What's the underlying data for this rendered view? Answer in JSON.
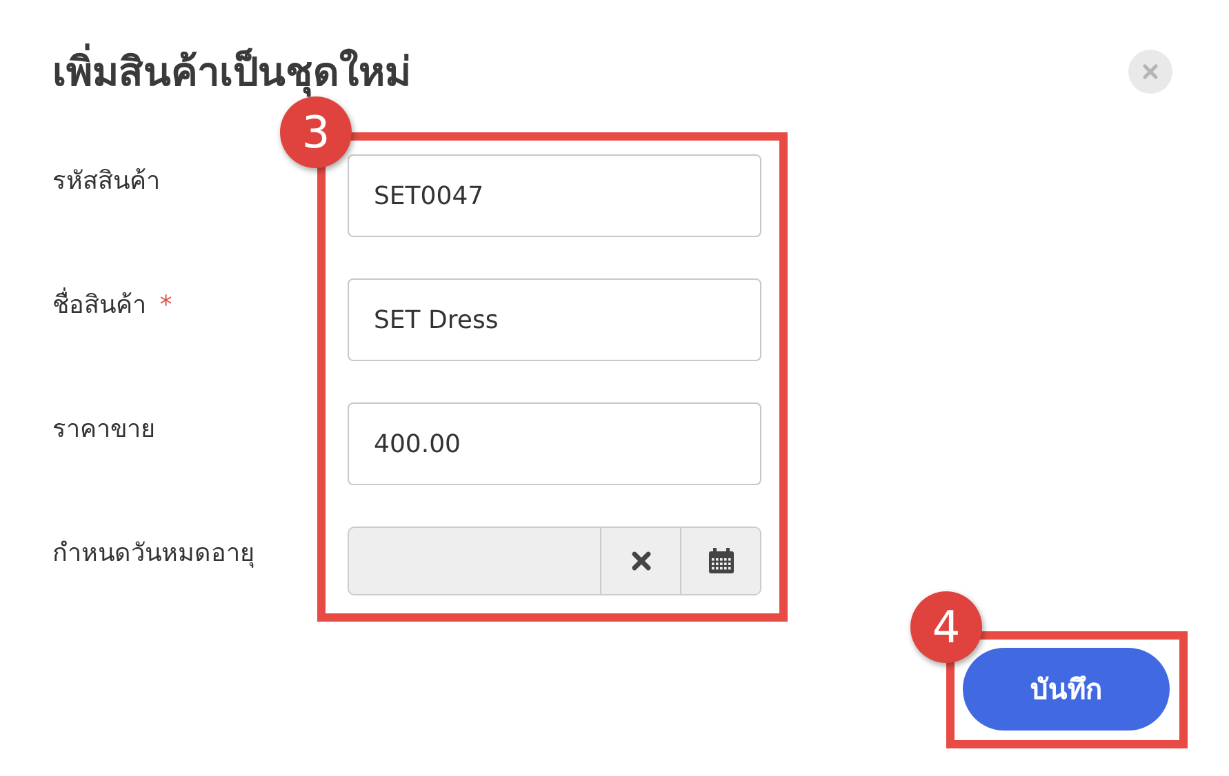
{
  "dialog": {
    "title": "เพิ่มสินค้าเป็นชุดใหม่"
  },
  "fields": [
    {
      "kind": "text",
      "label": "รหัสสินค้า",
      "value": "SET0047"
    },
    {
      "kind": "text",
      "label": "ชื่อสินค้า",
      "required_mark": "*",
      "value": "SET Dress"
    },
    {
      "kind": "text",
      "label": "ราคาขาย",
      "value": "400.00"
    },
    {
      "kind": "date",
      "label": "กำหนดวันหมดอายุ",
      "disabled": true
    }
  ],
  "save_button": {
    "label": "บันทึก"
  },
  "fields_badge": {
    "label": "3"
  },
  "save_badge": {
    "label": "4"
  }
}
